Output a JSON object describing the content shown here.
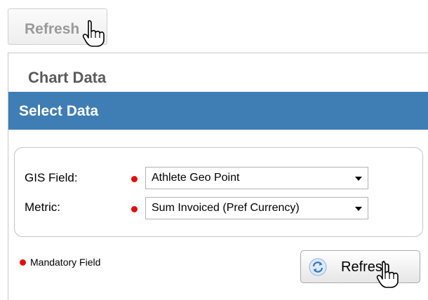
{
  "toolbar": {
    "refresh_label": "Refresh"
  },
  "panel": {
    "title": "Chart Data",
    "section_title": "Select Data",
    "fields": [
      {
        "label": "GIS Field:",
        "value": "Athlete Geo Point"
      },
      {
        "label": "Metric:",
        "value": "Sum Invoiced (Pref Currency)"
      }
    ],
    "mandatory_legend": "Mandatory Field",
    "refresh_label": "Refresh"
  },
  "colors": {
    "section_bar": "#3f7db5",
    "mandatory_dot": "#e20d0d"
  },
  "icons": {
    "cursor": "hand-pointer-icon",
    "refresh": "refresh-arrows-icon",
    "dropdown": "chevron-down-icon"
  }
}
